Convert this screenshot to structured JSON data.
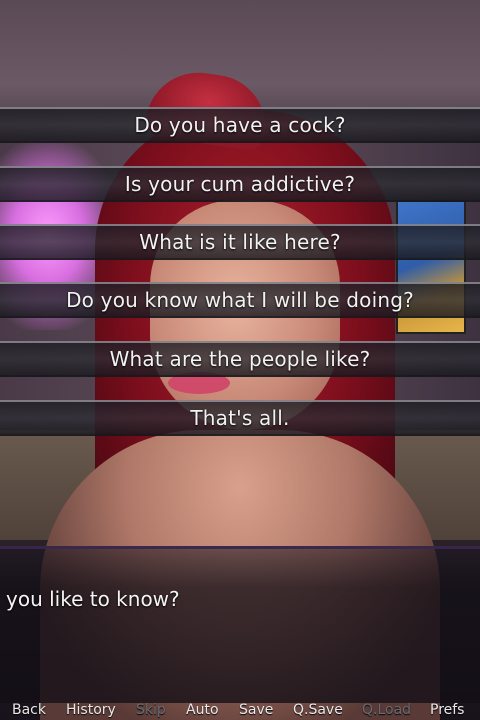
{
  "choices": [
    "Do you have a cock?",
    "Is your cum addictive?",
    "What is it like here?",
    "Do you know what I will be doing?",
    "What are the people like?",
    "That's all."
  ],
  "dialogue": "you like to know?",
  "quick_menu": {
    "back": "Back",
    "history": "History",
    "skip": "Skip",
    "auto": "Auto",
    "save": "Save",
    "qsave": "Q.Save",
    "qload": "Q.Load",
    "prefs": "Prefs",
    "disabled": [
      "Skip",
      "Q.Load"
    ]
  }
}
